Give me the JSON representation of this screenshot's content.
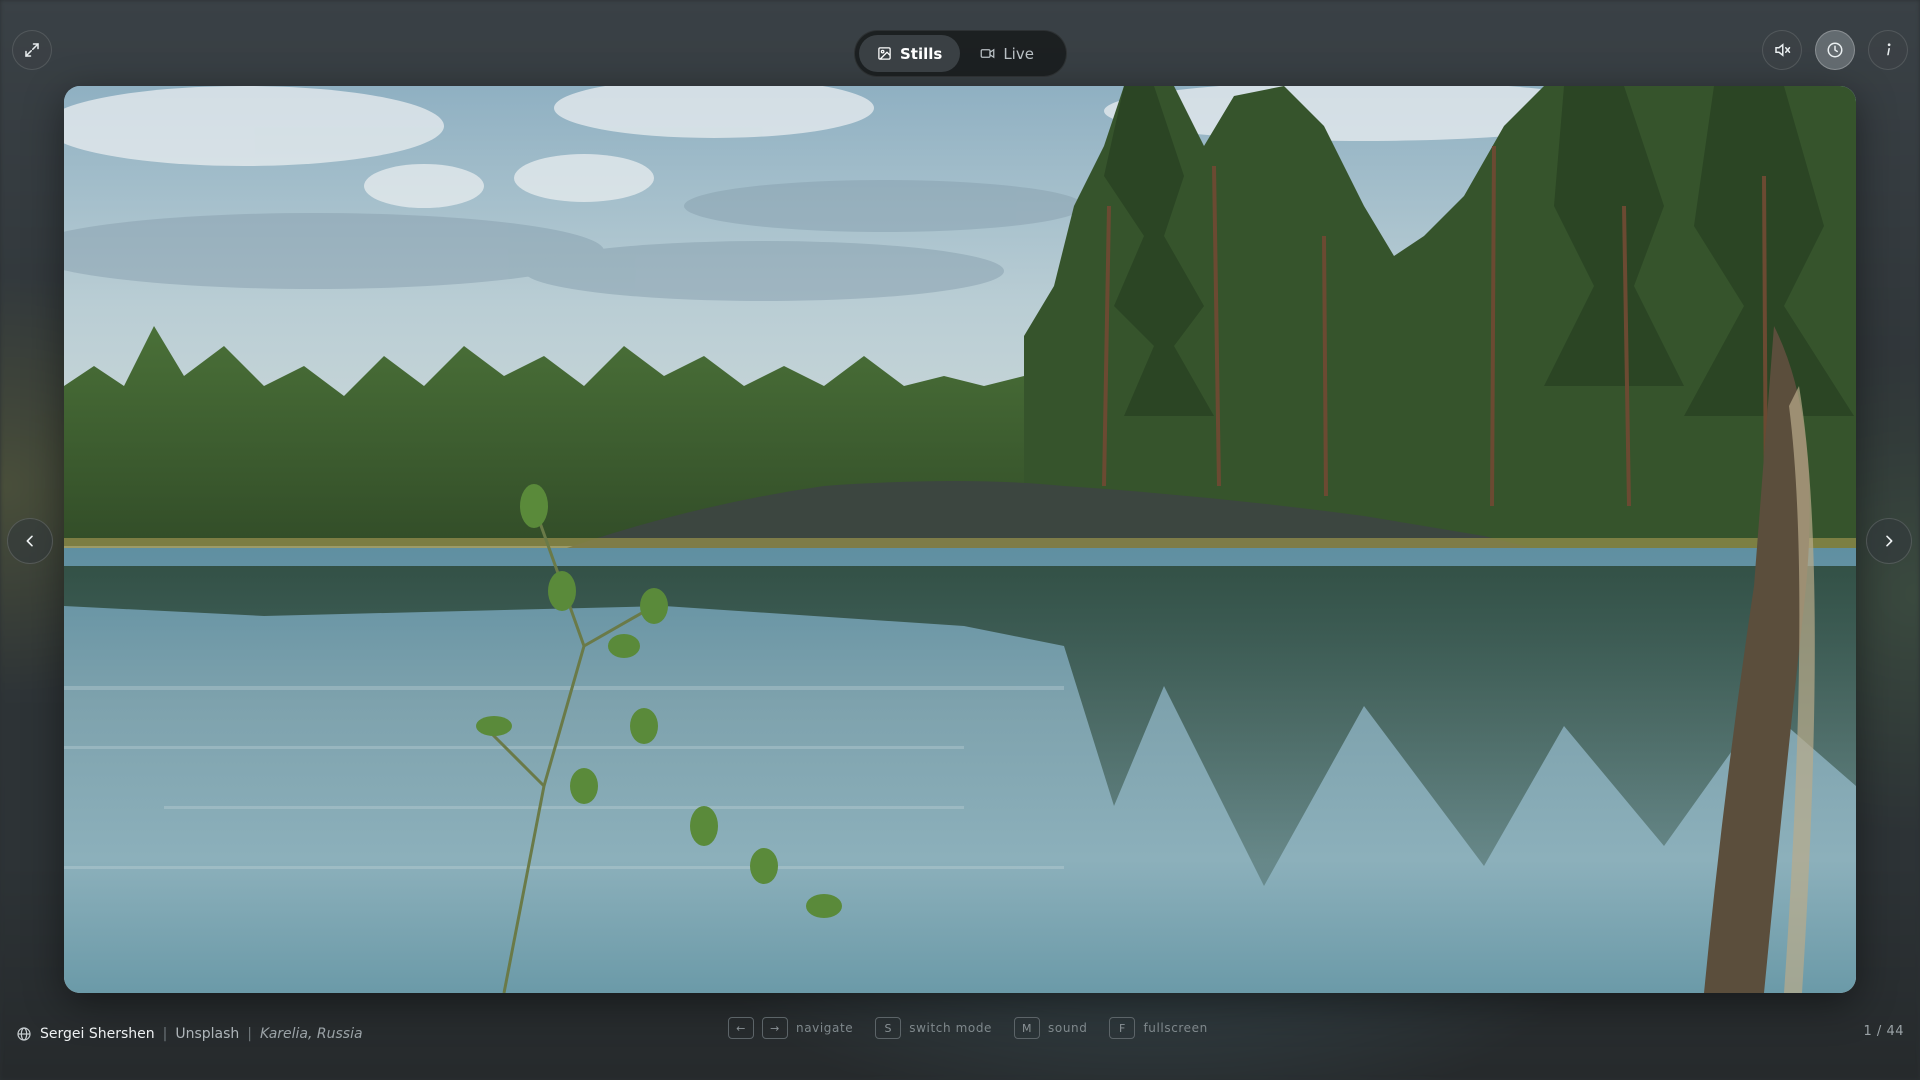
{
  "photo": {
    "alt_subject": "lake-forest-landscape"
  },
  "toolbar": {
    "modes": [
      {
        "label": "Stills",
        "icon": "image-icon",
        "selected": true
      },
      {
        "label": "Live",
        "icon": "video-icon",
        "selected": false
      }
    ],
    "icons": {
      "expand": "expand-icon",
      "mute": "volume-mute-icon",
      "history": "clock-icon",
      "info": "info-icon"
    }
  },
  "credit": {
    "author": "Sergei Shershen",
    "source": "Unsplash",
    "location": "Karelia, Russia",
    "separator": "|"
  },
  "hints": [
    {
      "keys": [
        "←",
        "→"
      ],
      "label": "navigate"
    },
    {
      "keys": [
        "S"
      ],
      "label": "switch mode"
    },
    {
      "keys": [
        "M"
      ],
      "label": "sound"
    },
    {
      "keys": [
        "F"
      ],
      "label": "fullscreen"
    }
  ],
  "counter": "1 / 44",
  "colors": {
    "accent": "#ffffff",
    "toggle_bg": "#181b1d",
    "selected_bg": "#3a4044"
  }
}
